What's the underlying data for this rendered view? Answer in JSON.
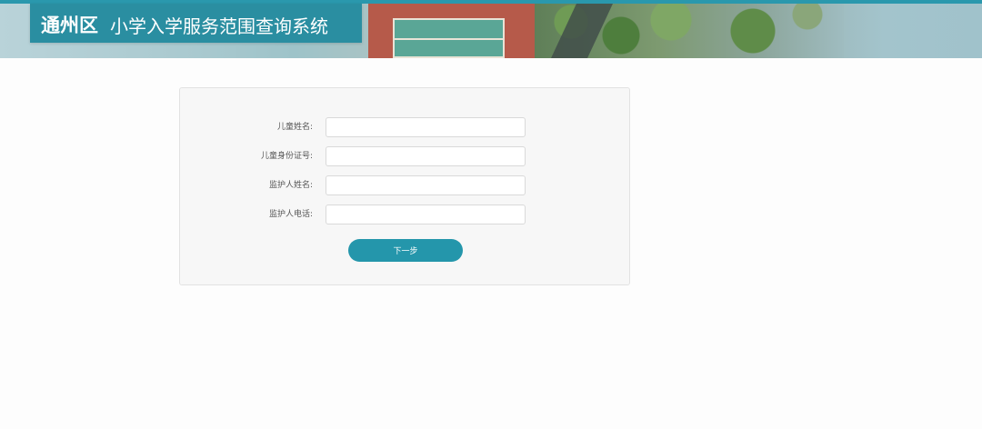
{
  "header": {
    "district": "通州区",
    "system_title": "小学入学服务范围查询系统"
  },
  "form": {
    "fields": [
      {
        "label": "儿童姓名:",
        "value": "",
        "placeholder": ""
      },
      {
        "label": "儿童身份证号:",
        "value": "",
        "placeholder": ""
      },
      {
        "label": "监护人姓名:",
        "value": "",
        "placeholder": ""
      },
      {
        "label": "监护人电话:",
        "value": "",
        "placeholder": ""
      }
    ],
    "next_label": "下一步"
  },
  "colors": {
    "accent": "#2496ab",
    "title_bg": "#2a8ea1"
  }
}
